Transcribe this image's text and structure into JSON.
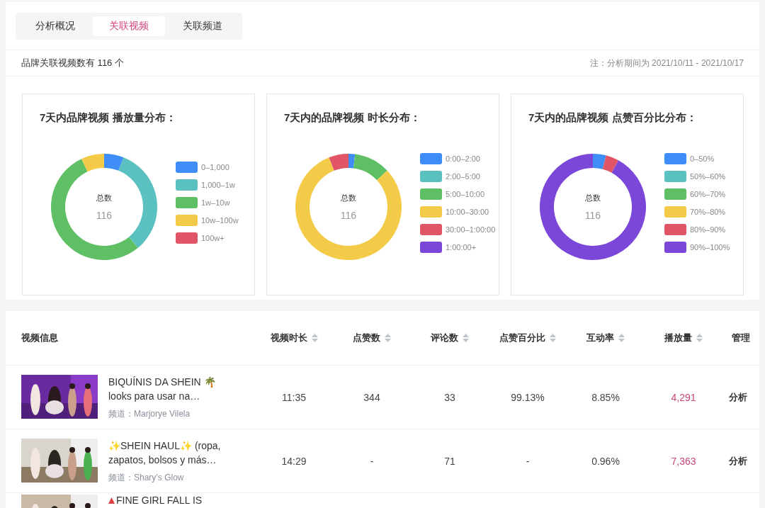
{
  "tabs": [
    {
      "label": "分析概况",
      "selected": false
    },
    {
      "label": "关联视频",
      "selected": true
    },
    {
      "label": "关联频道",
      "selected": false
    }
  ],
  "summary": "品牌关联视频数有 116 个",
  "period_note": "注：分析期间为 2021/10/11 - 2021/10/17",
  "charts": [
    {
      "center_label": "总数",
      "center_value": "116",
      "chart_data": {
        "type": "donut",
        "title": "7天内品牌视频 播放量分布：",
        "categories": [
          "0–1,000",
          "1,000–1w",
          "1w–10w",
          "10w–100w",
          "100w+"
        ],
        "values": [
          6,
          33,
          54,
          7,
          0
        ],
        "colors": [
          "#3f8ef7",
          "#5bc0c0",
          "#5fbf65",
          "#f3cb48",
          "#e05666"
        ]
      }
    },
    {
      "center_label": "总数",
      "center_value": "116",
      "chart_data": {
        "type": "donut",
        "title": "7天内的品牌视频 时长分布：",
        "categories": [
          "0:00–2:00",
          "2:00–5:00",
          "5:00–10:00",
          "10:00–30:00",
          "30:00–1:00:00",
          "1:00:00+"
        ],
        "values": [
          2,
          0,
          11,
          81,
          6,
          0
        ],
        "colors": [
          "#3f8ef7",
          "#5bc0c0",
          "#5fbf65",
          "#f3cb48",
          "#e05666",
          "#7b47d9"
        ]
      }
    },
    {
      "center_label": "总数",
      "center_value": "116",
      "chart_data": {
        "type": "donut",
        "title": "7天内的品牌视频 点赞百分比分布：",
        "categories": [
          "0–50%",
          "50%–60%",
          "60%–70%",
          "70%–80%",
          "80%–90%",
          "90%–100%"
        ],
        "values": [
          4,
          0,
          0,
          0,
          4,
          92
        ],
        "colors": [
          "#3f8ef7",
          "#5bc0c0",
          "#5fbf65",
          "#f3cb48",
          "#e05666",
          "#7b47d9"
        ]
      }
    }
  ],
  "table": {
    "columns": [
      {
        "label": "视频信息",
        "sortable": false
      },
      {
        "label": "视频时长",
        "sortable": true
      },
      {
        "label": "点赞数",
        "sortable": true
      },
      {
        "label": "评论数",
        "sortable": true
      },
      {
        "label": "点赞百分比",
        "sortable": true
      },
      {
        "label": "互动率",
        "sortable": true
      },
      {
        "label": "播放量",
        "sortable": true
      },
      {
        "label": "管理",
        "sortable": false
      }
    ],
    "rows": [
      {
        "title": "BIQUÍNIS DA SHEIN 🌴 looks para usar na…",
        "channel_label": "频道：",
        "channel": "Marjorye Vilela",
        "duration": "11:35",
        "likes": "344",
        "comments": "33",
        "like_ratio": "99.13%",
        "engagement": "8.85%",
        "views": "4,291",
        "action": "分析"
      },
      {
        "title": "✨SHEIN HAUL✨ (ropa, zapatos, bolsos y más…",
        "channel_label": "频道：",
        "channel": "Shary’s Glow",
        "duration": "14:29",
        "likes": "-",
        "comments": "71",
        "like_ratio": "-",
        "engagement": "0.96%",
        "views": "7,363",
        "action": "分析"
      }
    ],
    "partial_row": {
      "title": "FINE GIRL FALL IS"
    }
  }
}
